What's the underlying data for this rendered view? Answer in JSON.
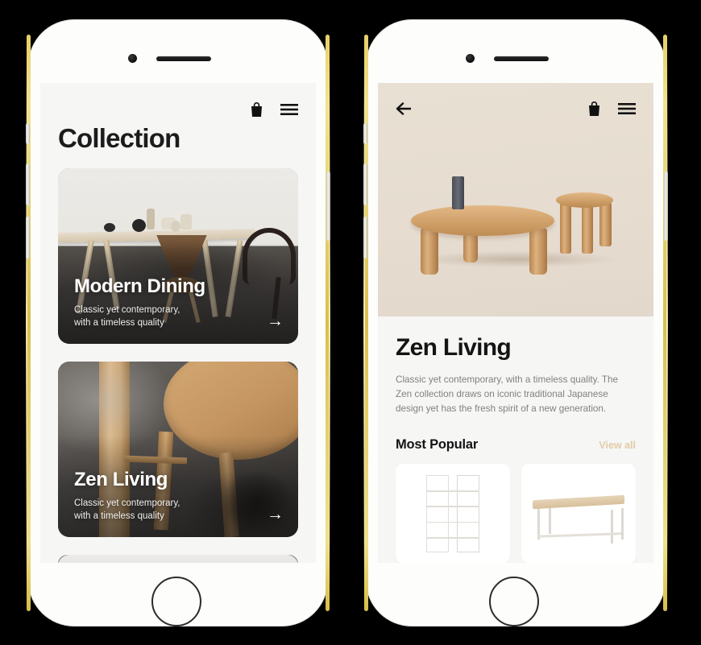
{
  "page": {
    "background_color": "#000000",
    "device_frame_color": "#fdfdfc",
    "device_rail_color": "#e8d067"
  },
  "left_phone": {
    "screen_background": "#f6f6f5",
    "header": {
      "title": "Collection",
      "icons": [
        {
          "name": "shopping-bag-icon",
          "glyph": "bag"
        },
        {
          "name": "hamburger-menu-icon",
          "glyph": "menu"
        }
      ]
    },
    "cards": [
      {
        "title": "Modern Dining",
        "subtitle_line1": "Classic yet contemporary,",
        "subtitle_line2": "with a timeless quality",
        "arrow": "→",
        "image_description": "Wooden dining table with a molded plywood chair on a concrete floor"
      },
      {
        "title": "Zen Living",
        "subtitle_line1": "Classic yet contemporary,",
        "subtitle_line2": "with a timeless quality",
        "arrow": "→",
        "image_description": "Close-up of solid oak round table legs"
      }
    ]
  },
  "right_phone": {
    "screen_background": "#f6f6f5",
    "hero": {
      "background_color": "#e9e0d4",
      "image_description": "Round wooden coffee table with matching stool and a dark vase",
      "back_icon": "←",
      "icons": [
        {
          "name": "shopping-bag-icon",
          "glyph": "bag"
        },
        {
          "name": "hamburger-menu-icon",
          "glyph": "menu"
        }
      ]
    },
    "detail": {
      "title": "Zen Living",
      "description": "Classic yet contemporary, with a timeless quality. The Zen collection draws on iconic traditional Japanese design yet has the fresh spirit of a new generation."
    },
    "section": {
      "heading": "Most Popular",
      "action_label": "View all",
      "action_color": "#e3cba6",
      "products": [
        {
          "name": "shelving-unit",
          "image_description": "White slim metal shelving unit"
        },
        {
          "name": "wooden-desk",
          "image_description": "Light oak desk with white legs"
        }
      ]
    }
  }
}
